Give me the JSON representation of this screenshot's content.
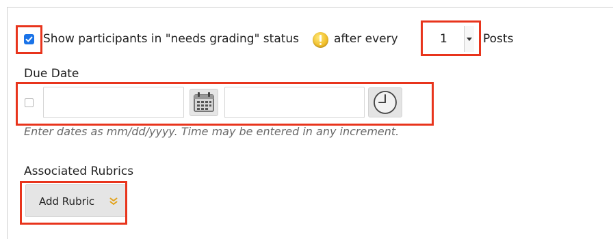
{
  "needs_grading": {
    "checked": true,
    "label_before": "Show participants in \"needs grading\" status",
    "icon": "warning-icon",
    "label_after": "after every",
    "posts_select_value": "1",
    "posts_label": "Posts"
  },
  "due_date": {
    "label": "Due Date",
    "enabled": false,
    "date_value": "",
    "time_value": "",
    "calendar_icon": "calendar-icon",
    "clock_icon": "clock-icon",
    "hint": "Enter dates as mm/dd/yyyy. Time may be entered in any increment."
  },
  "rubrics": {
    "label": "Associated Rubrics",
    "add_button_label": "Add Rubric",
    "add_button_icon": "double-chevron-down-icon"
  },
  "colors": {
    "highlight": "#e8341c",
    "checkbox_checked": "#1a73e8",
    "warning": "#f2c12e",
    "chevron": "#e2a21a",
    "button_bg": "#e5e5e5",
    "hint_text": "#6a6a6a"
  }
}
